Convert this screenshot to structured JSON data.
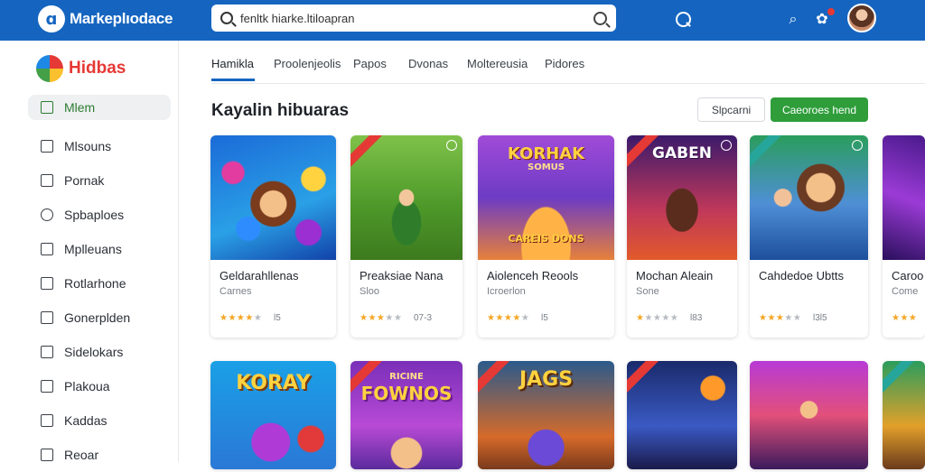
{
  "header": {
    "logo_text": "Markeplıodace",
    "search_value": "fenltk hiarke.ltiloapran"
  },
  "sidebar": {
    "brand": "Hidbas",
    "items": [
      {
        "label": "Mlem",
        "icon": "home-icon"
      },
      {
        "label": "Mlsouns",
        "icon": "box-icon"
      },
      {
        "label": "Pornak",
        "icon": "door-icon"
      },
      {
        "label": "Spbaploes",
        "icon": "compass-icon"
      },
      {
        "label": "Mplleuans",
        "icon": "chart-icon"
      },
      {
        "label": "Rotlarhone",
        "icon": "bookmark-icon"
      },
      {
        "label": "Gonerplden",
        "icon": "gamepad-icon"
      },
      {
        "label": "Sidelokars",
        "icon": "hammer-icon"
      },
      {
        "label": "Plakoua",
        "icon": "folder-icon"
      },
      {
        "label": "Kaddas",
        "icon": "list-icon"
      },
      {
        "label": "Reoar",
        "icon": "bag-icon"
      }
    ]
  },
  "tabs": [
    {
      "label": "Hamikla"
    },
    {
      "label": "Proolenjeolis"
    },
    {
      "label": "Papos"
    },
    {
      "label": "Dvonas"
    },
    {
      "label": "Moltereusia"
    },
    {
      "label": "Pidores"
    }
  ],
  "main": {
    "title": "Kayalin hibuaras",
    "btn_secondary": "Slpcarni",
    "btn_primary": "Caeoroes hend"
  },
  "cards": [
    {
      "name": "Geldarahllenas",
      "category": "Carnes",
      "rating": 4,
      "count": "l5"
    },
    {
      "name": "Preaksiae Nana",
      "category": "Sloo",
      "rating": 3,
      "count": "07-3"
    },
    {
      "name": "Aiolenceh Reools",
      "category": "Icroerlon",
      "rating": 4,
      "count": "l5"
    },
    {
      "name": "Mochan Aleain",
      "category": "Sone",
      "rating": 1,
      "count": "l83"
    },
    {
      "name": "Cahdedoe Ubtts",
      "category": "",
      "rating": 3,
      "count": "l3l5"
    },
    {
      "name": "Caroo",
      "category": "Come",
      "rating": 4,
      "count": ""
    }
  ],
  "thumb_titles": {
    "card3": "KORHAK",
    "card3_sub": "SOMUS",
    "card3_bottom": "CAREIS DONS",
    "card4": "GABEN",
    "row2_1": "KORAY",
    "row2_2": "FOWNOS",
    "row2_2_top": "RICINE",
    "row2_3": "JAGS"
  },
  "colors": {
    "topbar": "#1565c0",
    "accent_green": "#2e9d3a",
    "star": "#f5a623"
  }
}
